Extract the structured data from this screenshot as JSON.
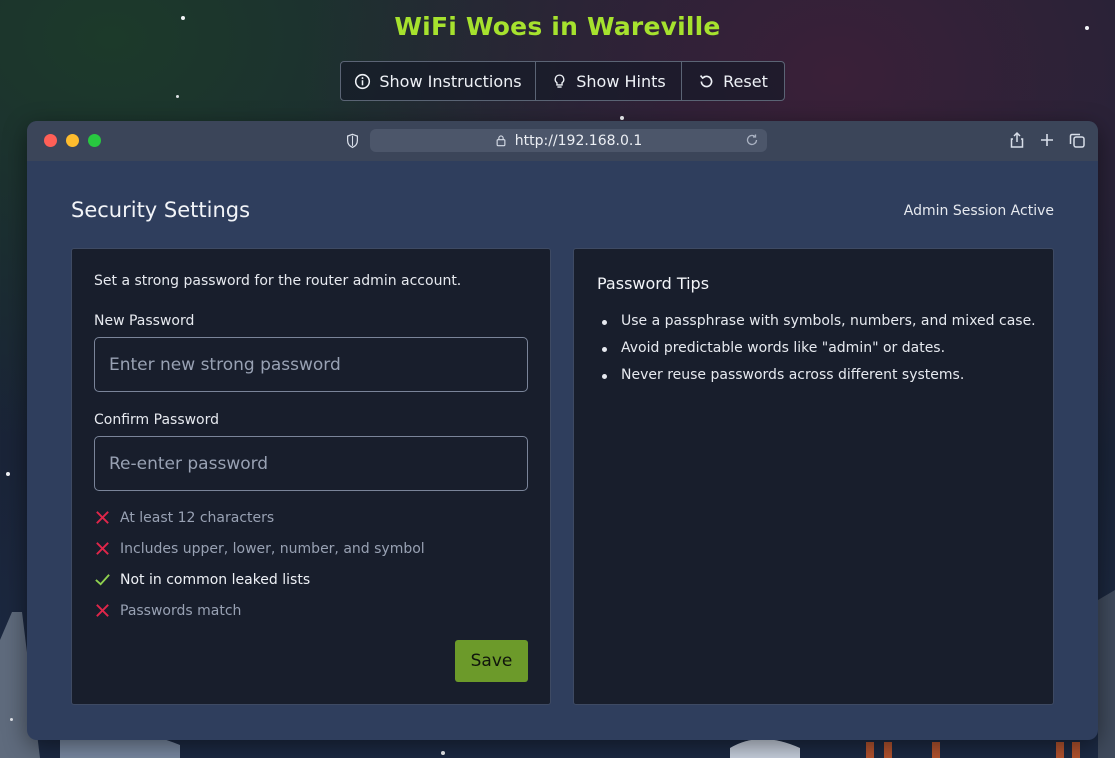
{
  "game": {
    "title": "WiFi Woes in Wareville"
  },
  "toolbar": {
    "instructions_label": "Show Instructions",
    "hints_label": "Show Hints",
    "reset_label": "Reset"
  },
  "browser": {
    "url": "http://192.168.0.1",
    "traffic_lights": [
      "#ff5f57",
      "#febc2e",
      "#28c840"
    ]
  },
  "page": {
    "title": "Security Settings",
    "session_status": "Admin Session Active"
  },
  "form": {
    "intro": "Set a strong password for the router admin account.",
    "new_password_label": "New Password",
    "new_password_placeholder": "Enter new strong password",
    "confirm_password_label": "Confirm Password",
    "confirm_password_placeholder": "Re-enter password",
    "requirements": [
      {
        "text": "At least 12 characters",
        "met": false
      },
      {
        "text": "Includes upper, lower, number, and symbol",
        "met": false
      },
      {
        "text": "Not in common leaked lists",
        "met": true
      },
      {
        "text": "Passwords match",
        "met": false
      }
    ],
    "save_label": "Save"
  },
  "tips": {
    "title": "Password Tips",
    "items": [
      "Use a passphrase with symbols, numbers, and mixed case.",
      "Avoid predictable words like \"admin\" or dates.",
      "Never reuse passwords across different systems."
    ]
  },
  "colors": {
    "accent": "#a6e22e",
    "save_button": "#6c9a2a",
    "unmet": "#e0264a",
    "met": "#8fd14f"
  }
}
